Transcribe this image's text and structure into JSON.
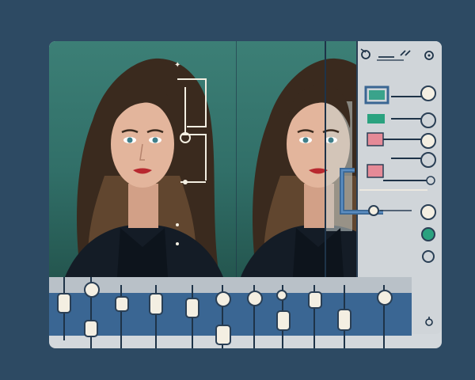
{
  "app": {
    "accent_teal": "#3c7f76",
    "accent_blue": "#3a6693",
    "accent_pink": "#e58a97",
    "accent_green": "#2aa27f",
    "background": "#2d4a63"
  },
  "side_panel": {
    "tools": [
      "pencil-icon",
      "settings-icon",
      "tag-icon"
    ],
    "swatches": [
      {
        "name": "teal-swatch",
        "color": "#3aa38b"
      },
      {
        "name": "green-swatch",
        "color": "#2aa27f"
      },
      {
        "name": "pink-swatch",
        "color": "#e58a97"
      },
      {
        "name": "pink-swatch-2",
        "color": "#e58a97"
      }
    ],
    "toggle_states": [
      "on",
      "off",
      "on",
      "off",
      "off",
      "on",
      "on-green",
      "off"
    ]
  },
  "sliders": {
    "count": 10,
    "levels": [
      0.55,
      0.72,
      0.5,
      0.55,
      0.45,
      0.3,
      0.55,
      0.5,
      0.45,
      0.55
    ]
  }
}
